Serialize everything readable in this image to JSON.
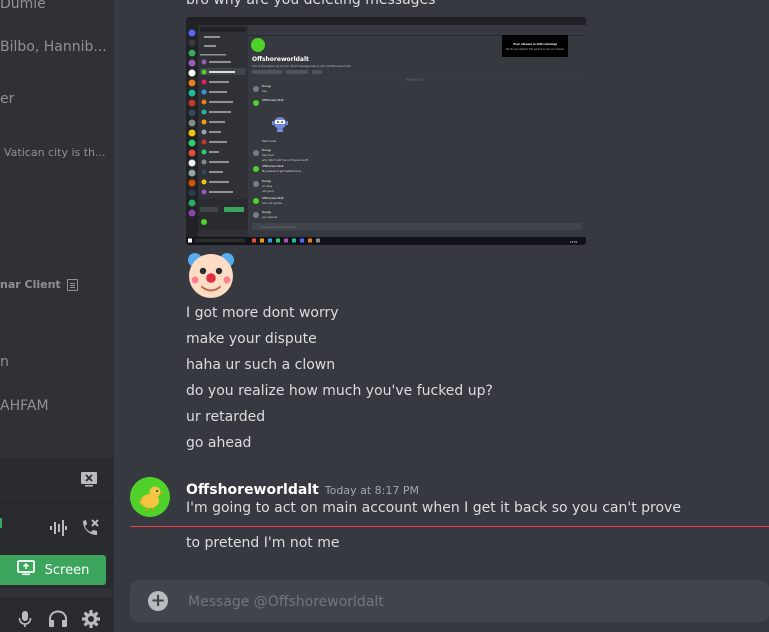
{
  "sidebar": {
    "dm_items": [
      {
        "text": "Dumle"
      },
      {
        "text": "Bilbo, Hannib..."
      },
      {
        "text": "er"
      },
      {
        "text": "Vatican city is th..."
      },
      {
        "text": "nar Client"
      },
      {
        "text": "n"
      },
      {
        "text": "AHFAM"
      }
    ],
    "screen_button_label": "Screen"
  },
  "chat": {
    "top_message": "bro why are you deleting messages",
    "embedded_screenshot": {
      "server_title": "Offshoreworldalt",
      "welcome_line": "This is the beginning of your direct message history with @Offshoreworldalt.",
      "date_divider": "August 8, 2021",
      "stream_title": "Your stream is still running!",
      "stream_text": "We hit your stream? This window is now your stream.",
      "messages": [
        {
          "author": "Energy",
          "time": "Today at 5:43 PM",
          "text": "hey"
        },
        {
          "author": "Offshoreworldalt",
          "time": "Today at 5:44 PM",
          "text": ""
        },
        {
          "author": "",
          "time": "",
          "text": "Hello lucas"
        },
        {
          "author": "Energy",
          "time": "Today at 5:46 PM",
          "text": "hey bruh"
        },
        {
          "author": "",
          "time": "",
          "text": "why didn't add me on this account?"
        },
        {
          "author": "Offshoreworldalt",
          "time": "Today at 5:46 PM",
          "text": "My password got deleted bruv"
        },
        {
          "author": "Energy",
          "time": "Today at 5:47 PM",
          "text": "oh okay"
        },
        {
          "author": "",
          "time": "",
          "text": "not good"
        },
        {
          "author": "Offshoreworldalt",
          "time": "Today at 5:47 PM",
          "text": "he's not goode..."
        },
        {
          "author": "Energy",
          "time": "Today at 5:47 PM",
          "text": "you warned"
        }
      ],
      "composer_placeholder": "Message @Offshoreworldalt",
      "taskbar_clock": "17:51"
    },
    "lines": [
      "I got more dont worry",
      "make your dispute",
      "haha ur such a clown",
      "do you realize how much you've fucked up?",
      "ur retarded",
      "go ahead"
    ],
    "last_group": {
      "author": "Offshoreworldalt",
      "timestamp": "Today at 8:17 PM",
      "line1": "I'm going to act on main account when I get it back so you can't prove",
      "line2": "to pretend I'm not me"
    }
  },
  "composer": {
    "placeholder": "Message @Offshoreworldalt"
  },
  "colors": {
    "background": "#36393f",
    "sidebar": "#2f3136",
    "accent_green": "#3ba55d",
    "new_divider_red": "#ed4245",
    "avatar_green": "#4fd12a"
  },
  "icons": [
    "close-screen-icon",
    "waveform-icon",
    "phone-disconnect-icon",
    "monitor-icon",
    "microphone-icon",
    "headphones-icon",
    "gear-icon",
    "plus-circle-icon",
    "clown-face-icon",
    "chick-avatar-icon"
  ]
}
